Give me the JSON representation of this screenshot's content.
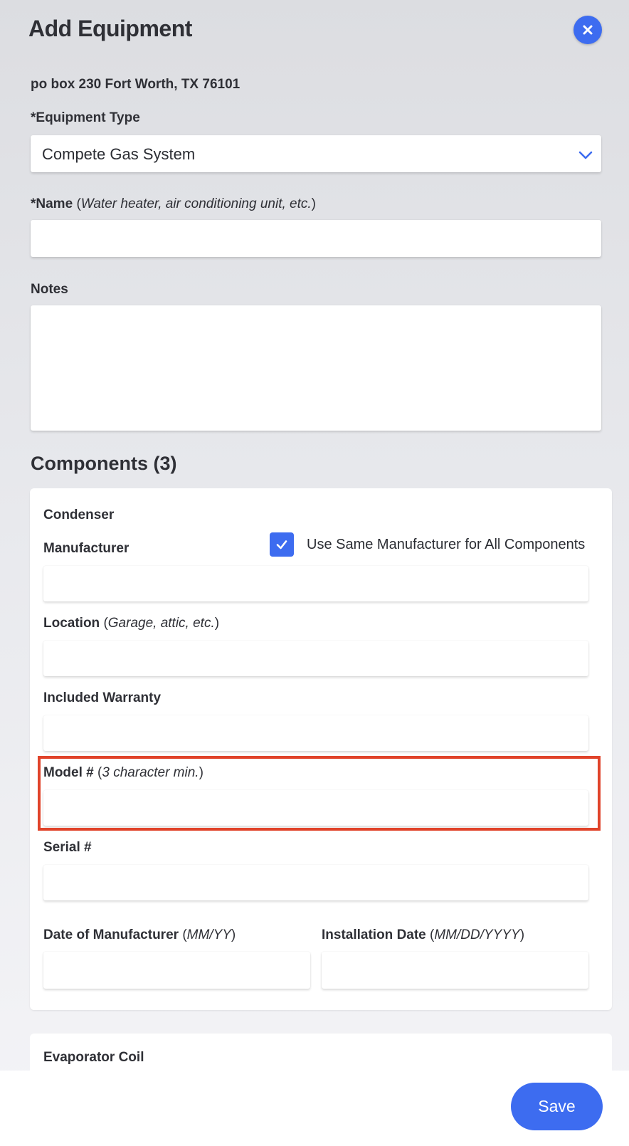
{
  "header": {
    "title": "Add Equipment",
    "close_icon": "close-icon"
  },
  "address": "po box 230 Fort Worth, TX 76101",
  "equipment_type": {
    "label": "*Equipment Type",
    "value": "Compete Gas System"
  },
  "name": {
    "label": "*Name",
    "hint": "Water heater, air conditioning unit, etc.",
    "value": ""
  },
  "notes": {
    "label": "Notes",
    "value": ""
  },
  "components": {
    "title": "Components (3)",
    "condenser": {
      "title": "Condenser",
      "manufacturer_label": "Manufacturer",
      "same_manufacturer_label": "Use Same Manufacturer for All Components",
      "same_manufacturer_checked": true,
      "location_label": "Location",
      "location_hint": "Garage, attic, etc.",
      "warranty_label": "Included Warranty",
      "model_label": "Model #",
      "model_hint": "3 character min.",
      "serial_label": "Serial #",
      "date_mfg_label": "Date of Manufacturer",
      "date_mfg_hint": "MM/YY",
      "install_date_label": "Installation Date",
      "install_date_hint": "MM/DD/YYYY"
    },
    "evaporator": {
      "title": "Evaporator Coil"
    }
  },
  "footer": {
    "save_label": "Save"
  },
  "colors": {
    "accent": "#3d6cf0",
    "highlight": "#e0432a"
  }
}
